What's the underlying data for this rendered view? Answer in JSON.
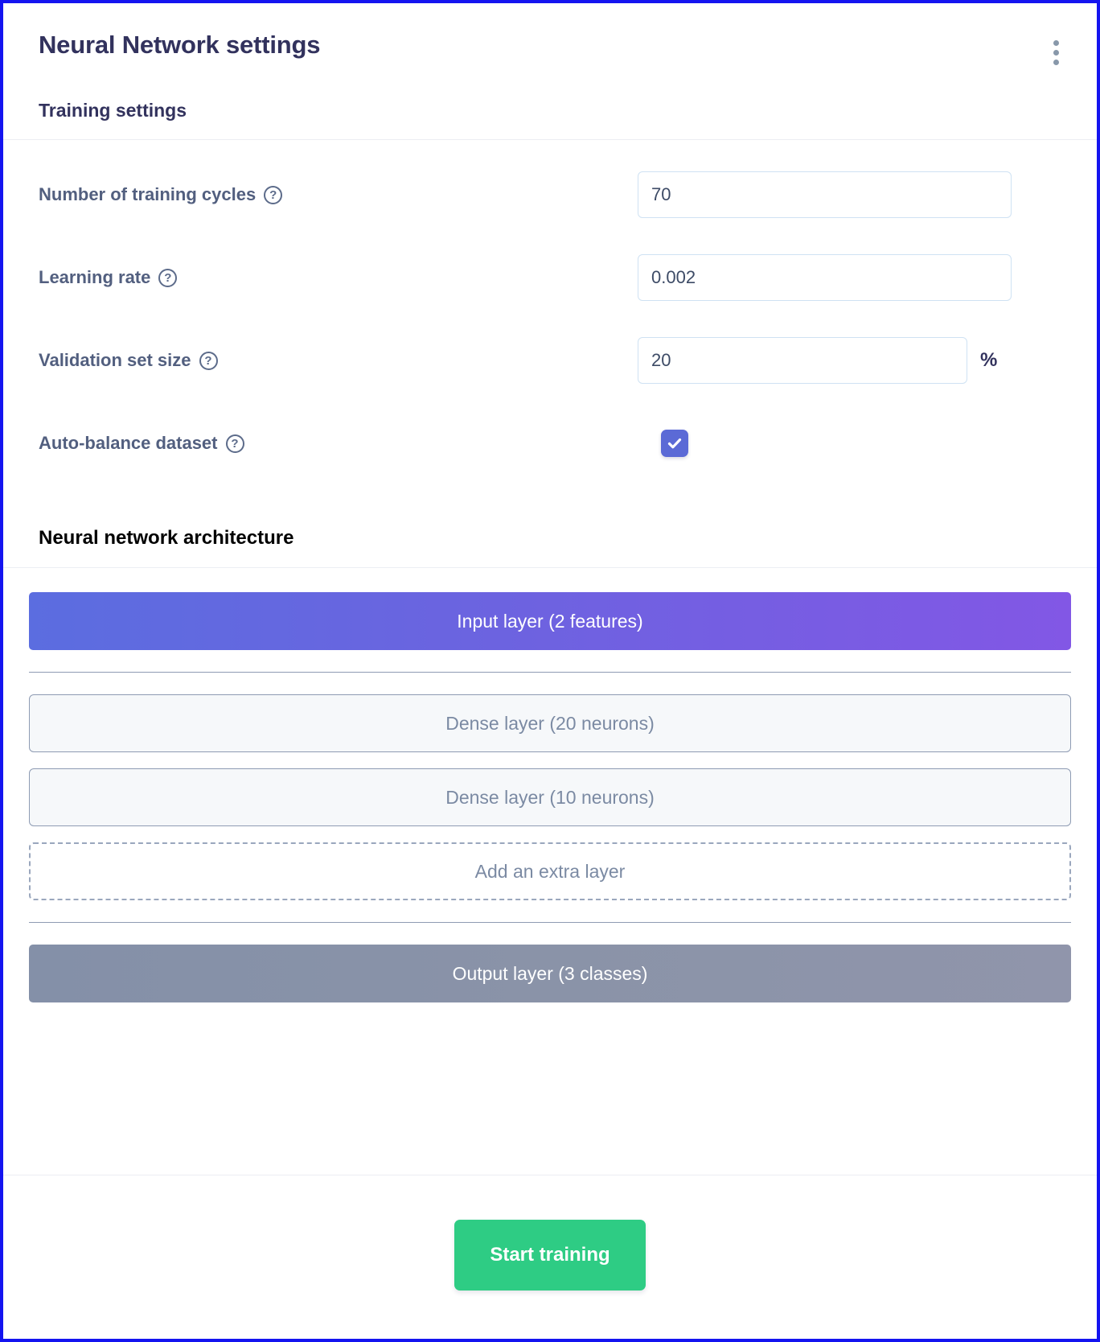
{
  "header": {
    "title": "Neural Network settings",
    "menu_icon": "kebab-menu-icon"
  },
  "training_settings": {
    "heading": "Training settings",
    "fields": [
      {
        "label": "Number of training cycles",
        "help_icon": "help-circle-icon",
        "value": "70",
        "placeholder": "",
        "unit": ""
      },
      {
        "label": "Learning rate",
        "help_icon": "help-circle-icon",
        "value": "0.002",
        "placeholder": "",
        "unit": ""
      },
      {
        "label": "Validation set size",
        "help_icon": "help-circle-icon",
        "value": "20",
        "placeholder": "",
        "unit": "%"
      }
    ],
    "checkbox_field": {
      "label": "Auto-balance dataset",
      "help_icon": "help-circle-icon",
      "checked": true,
      "check_icon": "checkmark-icon"
    }
  },
  "architecture": {
    "heading": "Neural network architecture",
    "input_layer": "Input layer (2 features)",
    "hidden_layers": [
      "Dense layer (20 neurons)",
      "Dense layer (10 neurons)"
    ],
    "add_layer": "Add an extra layer",
    "output_layer": "Output layer (3 classes)"
  },
  "footer": {
    "start_button": "Start training"
  },
  "colors": {
    "accent_indigo": "#5b6ad6",
    "input_gradient_start": "#5b6de0",
    "input_gradient_end": "#8257e5",
    "output_gradient_start": "#8490a8",
    "output_gradient_end": "#9095ab",
    "start_button_green": "#2ecc84",
    "title_navy": "#32325d",
    "label_slate": "#525f7f",
    "page_border_blue": "#1414f0"
  }
}
